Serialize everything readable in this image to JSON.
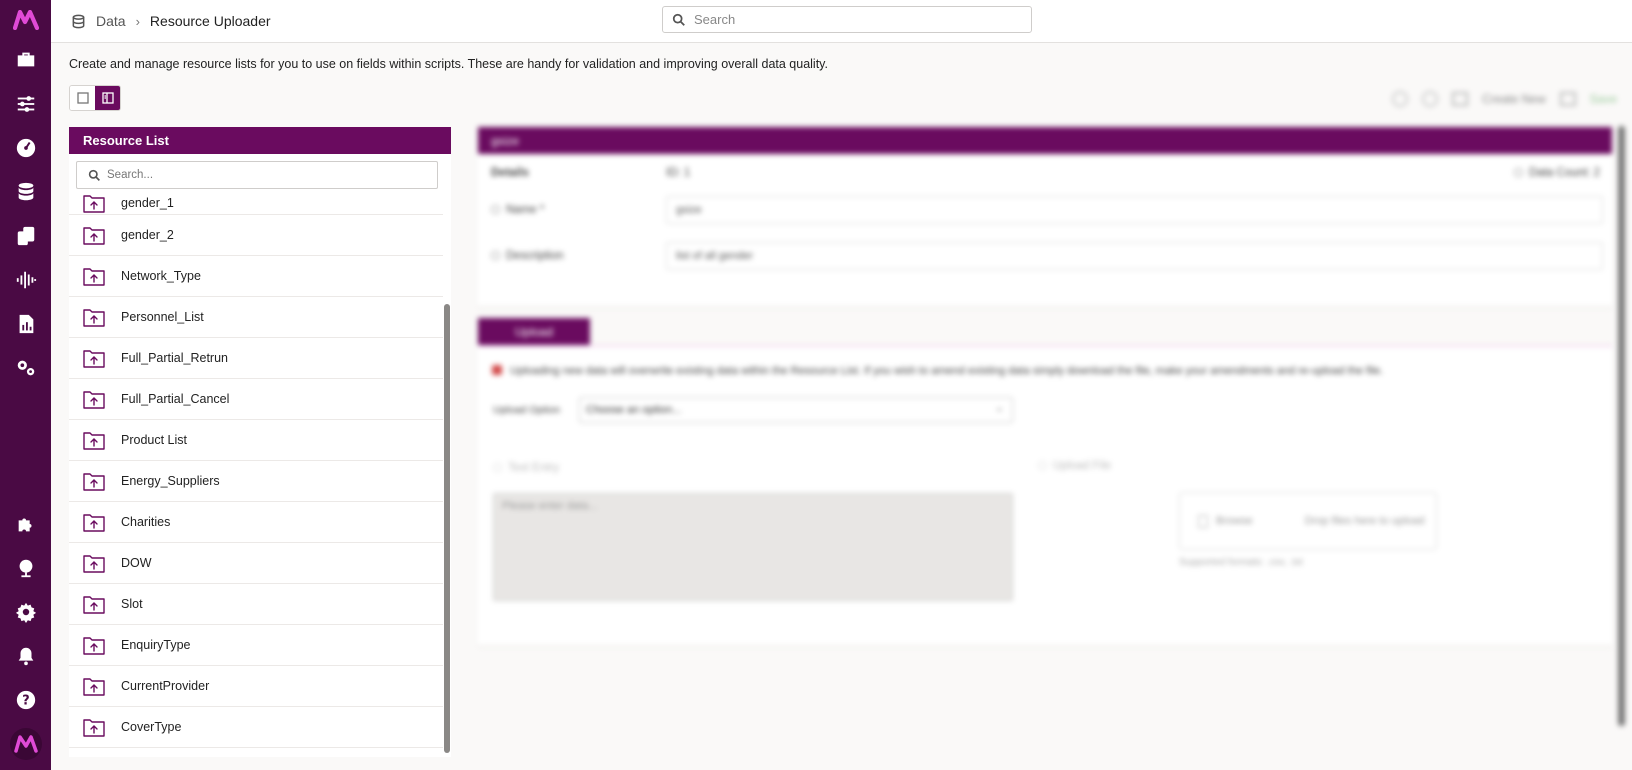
{
  "brand": {
    "logo": "M"
  },
  "sidebar": {
    "items": [
      {
        "name": "toolbox-icon"
      },
      {
        "name": "sliders-icon"
      },
      {
        "name": "dashboard-icon"
      },
      {
        "name": "database-icon"
      },
      {
        "name": "phone-copy-icon"
      },
      {
        "name": "audio-wave-icon"
      },
      {
        "name": "report-icon"
      },
      {
        "name": "gears-icon"
      }
    ],
    "bottom_items": [
      {
        "name": "puzzle-icon"
      },
      {
        "name": "globe-icon"
      },
      {
        "name": "settings-icon"
      },
      {
        "name": "bell-icon"
      },
      {
        "name": "help-icon"
      }
    ]
  },
  "header": {
    "breadcrumb_root": "Data",
    "breadcrumb_separator": "›",
    "breadcrumb_current": "Resource Uploader",
    "search_placeholder": "Search"
  },
  "intro_text": "Create and manage resource lists for you to use on fields within scripts. These are handy for validation and improving overall data quality.",
  "resource_list": {
    "title": "Resource List",
    "search_placeholder": "Search...",
    "items": [
      "gender_1",
      "gender_2",
      "Network_Type",
      "Personnel_List",
      "Full_Partial_Retrun",
      "Full_Partial_Cancel",
      "Product List",
      "Energy_Suppliers",
      "Charities",
      "DOW",
      "Slot",
      "EnquiryType",
      "CurrentProvider",
      "CoverType"
    ]
  },
  "detail": {
    "toolbar": {
      "create_new": "Create New",
      "save": "Save"
    },
    "header_title": "gsize",
    "details_label": "Details",
    "id_value": "ID: 1",
    "data_count": "Data Count: 2",
    "name_label": "Name *",
    "name_value": "gsize",
    "description_label": "Description",
    "description_value": "list of all gender",
    "upload_tab": "Upload",
    "upload_warning": "Uploading new data will overwrite existing data within the Resource List. If you wish to amend existing data simply download the file, make your amendments and re-upload the file.",
    "upload_option_label": "Upload Option",
    "upload_option_value": "Choose an option...",
    "text_entry_label": "Text Entry",
    "text_entry_placeholder": "Please enter data...",
    "upload_file_label": "Upload File",
    "browse_label": "Browse",
    "drop_text": "Drop files here to upload",
    "supported_formats": "Supported formats: .csv, .txt"
  },
  "colors": {
    "sidebar_bg": "#4a0a44",
    "accent": "#6a0b5f",
    "logo_pink": "#e04ad6"
  }
}
